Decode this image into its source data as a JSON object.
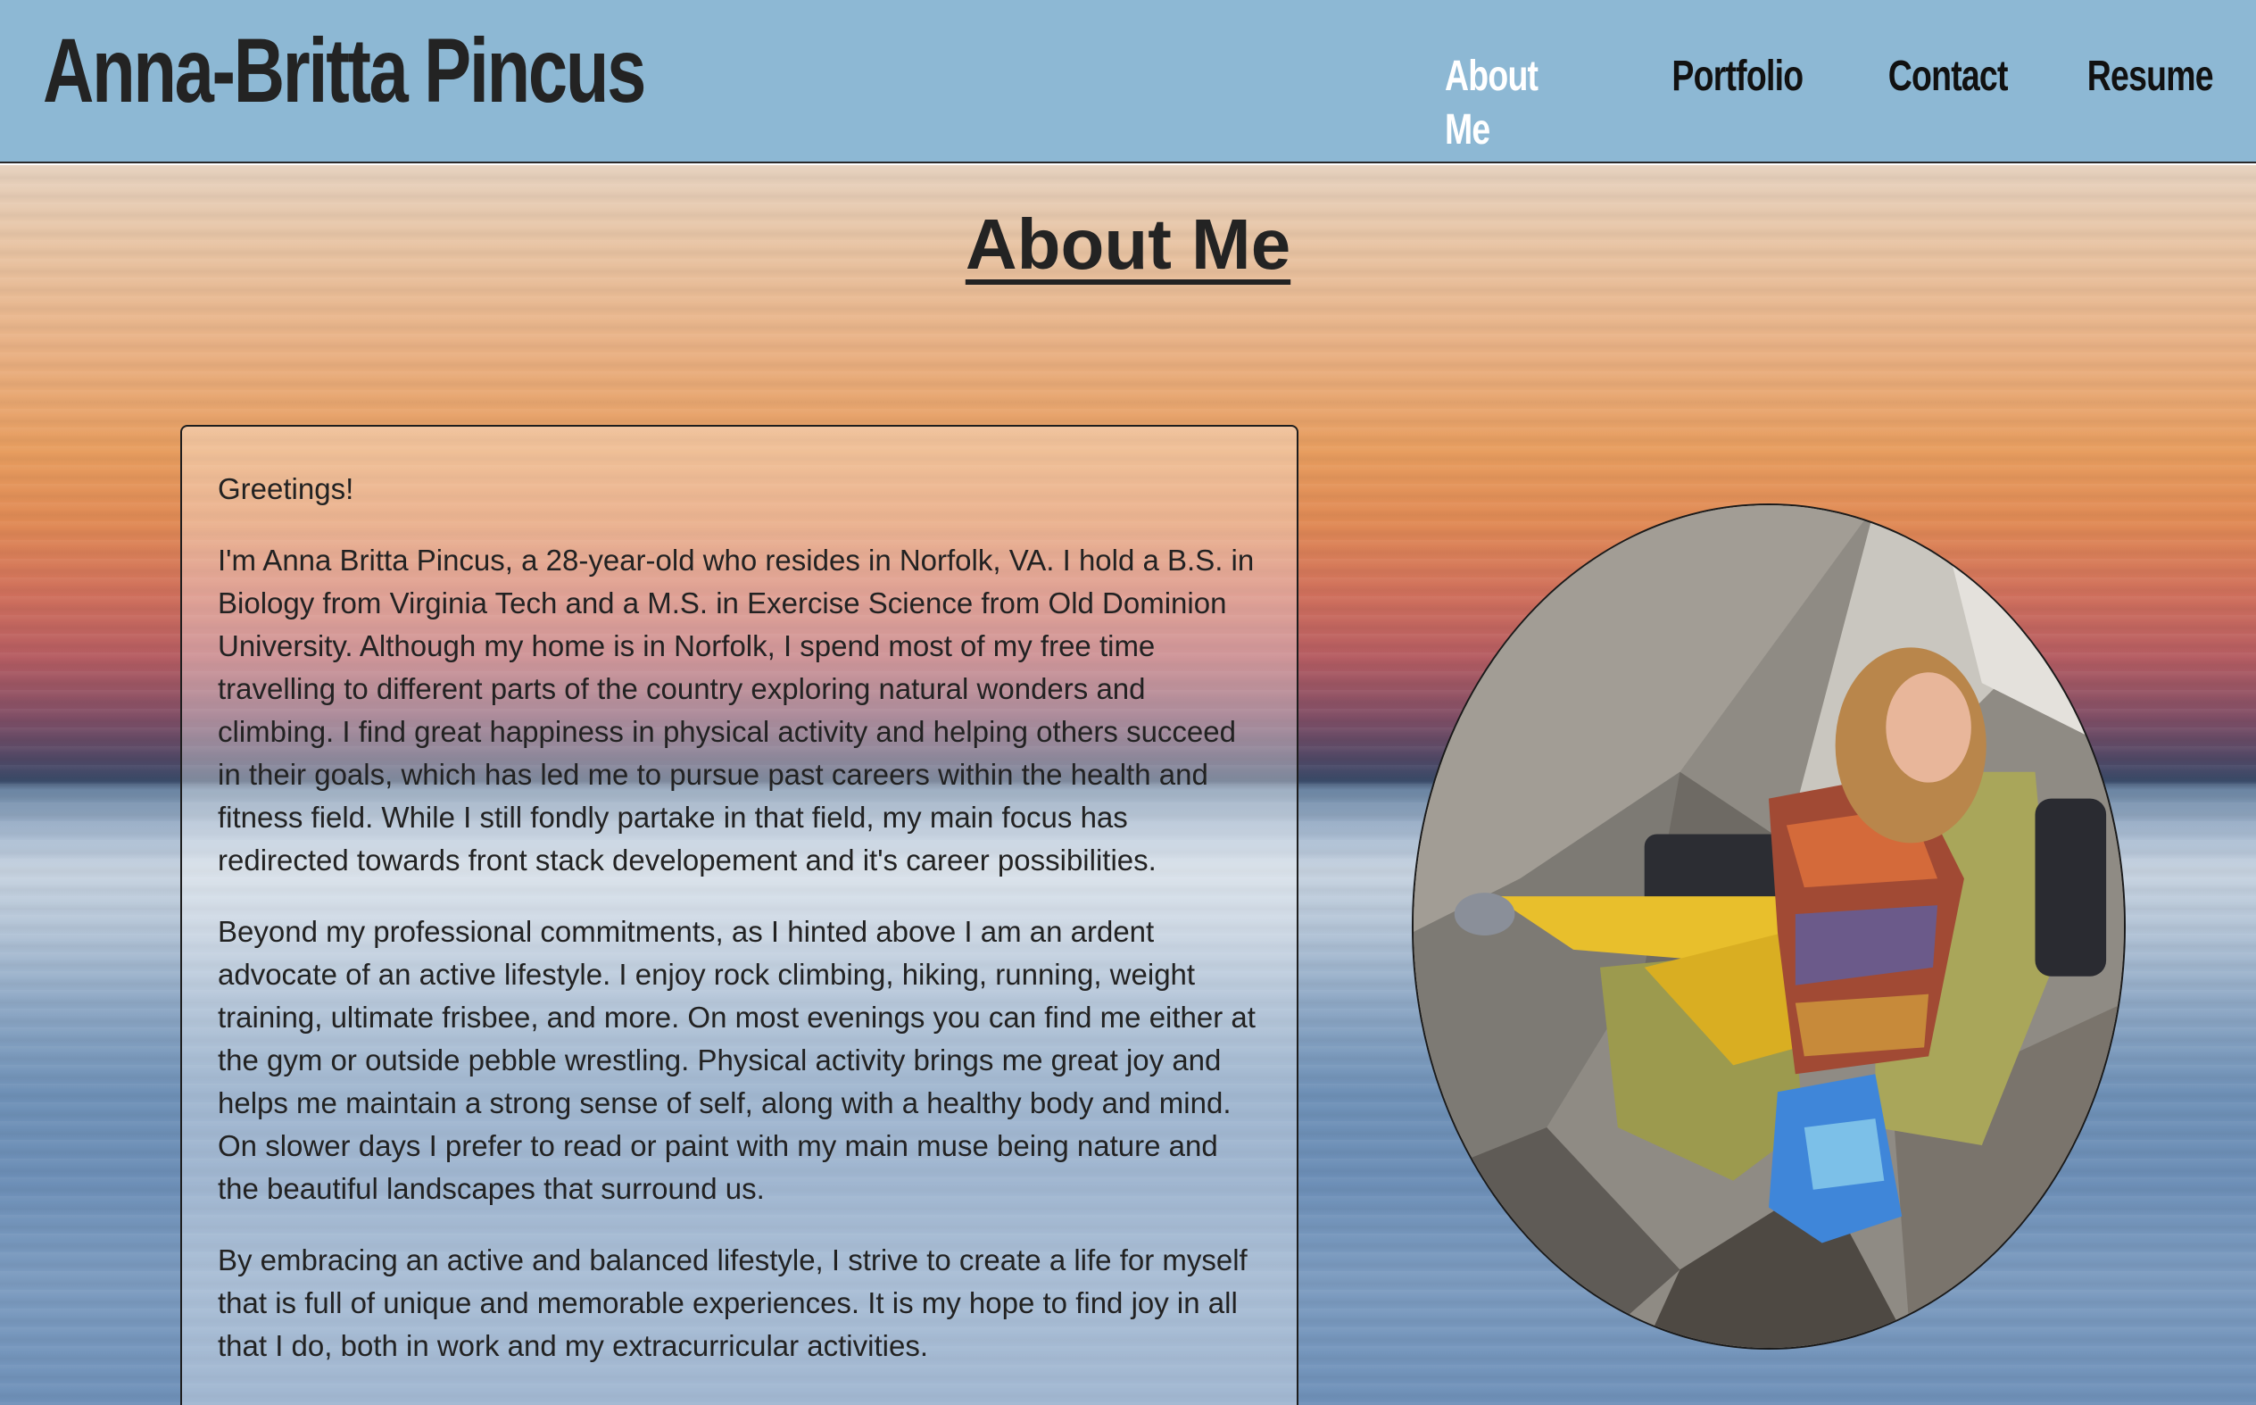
{
  "header": {
    "site_title": "Anna-Britta Pincus",
    "nav": [
      {
        "label": "About Me",
        "active": true
      },
      {
        "label": "Portfolio",
        "active": false
      },
      {
        "label": "Contact",
        "active": false
      },
      {
        "label": "Resume",
        "active": false
      }
    ]
  },
  "main": {
    "heading": "About Me",
    "paragraphs": [
      "Greetings!",
      "I'm Anna Britta Pincus, a 28-year-old who resides in Norfolk, VA. I hold a B.S. in Biology from Virginia Tech and a M.S. in Exercise Science from Old Dominion University. Although my home is in Norfolk, I spend most of my free time travelling to different parts of the country exploring natural wonders and climbing. I find great happiness in physical activity and helping others succeed in their goals, which has led me to pursue past careers within the health and fitness field. While I still fondly partake in that field, my main focus has redirected towards front stack developement and it's career possibilities.",
      "Beyond my professional commitments, as I hinted above I am an ardent advocate of an active lifestyle. I enjoy rock climbing, hiking, running, weight training, ultimate frisbee, and more. On most evenings you can find me either at the gym or outside pebble wrestling. Physical activity brings me great joy and helps me maintain a strong sense of self, along with a healthy body and mind. On slower days I prefer to read or paint with my main muse being nature and the beautiful landscapes that surround us.",
      "By embracing an active and balanced lifestyle, I strive to create a life for myself that is full of unique and memorable experiences. It is my hope to find joy in all that I do, both in work and my extracurricular activities."
    ]
  },
  "colors": {
    "header_bg": "#8db8d4",
    "nav_active": "#ffffff",
    "nav_default": "#111111",
    "text": "#222222"
  }
}
